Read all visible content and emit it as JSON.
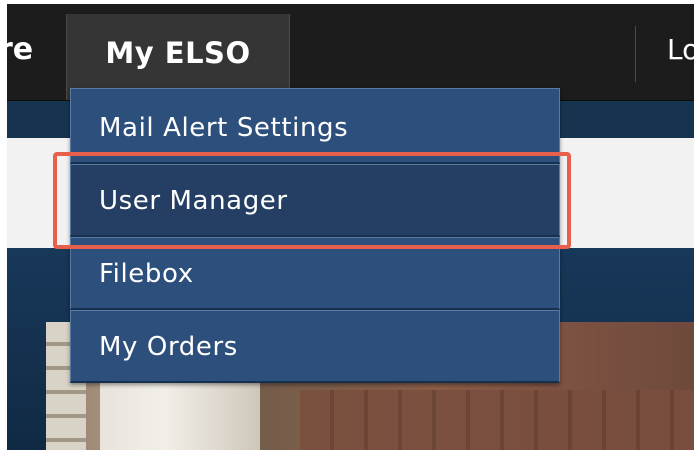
{
  "navbar": {
    "left_partial_label": "re",
    "active_tab_label": "My ELSO",
    "right_partial_label": "Lo"
  },
  "dropdown": {
    "items": [
      {
        "label": "Mail Alert Settings"
      },
      {
        "label": "User Manager"
      },
      {
        "label": "Filebox"
      },
      {
        "label": "My Orders"
      }
    ]
  },
  "colors": {
    "navbar_bg": "#1c1c1c",
    "active_tab_bg": "#353535",
    "menu_item_bg": "#2d4f7b",
    "highlight_border": "#e8604c",
    "page_dark_blue": "#16344f"
  }
}
